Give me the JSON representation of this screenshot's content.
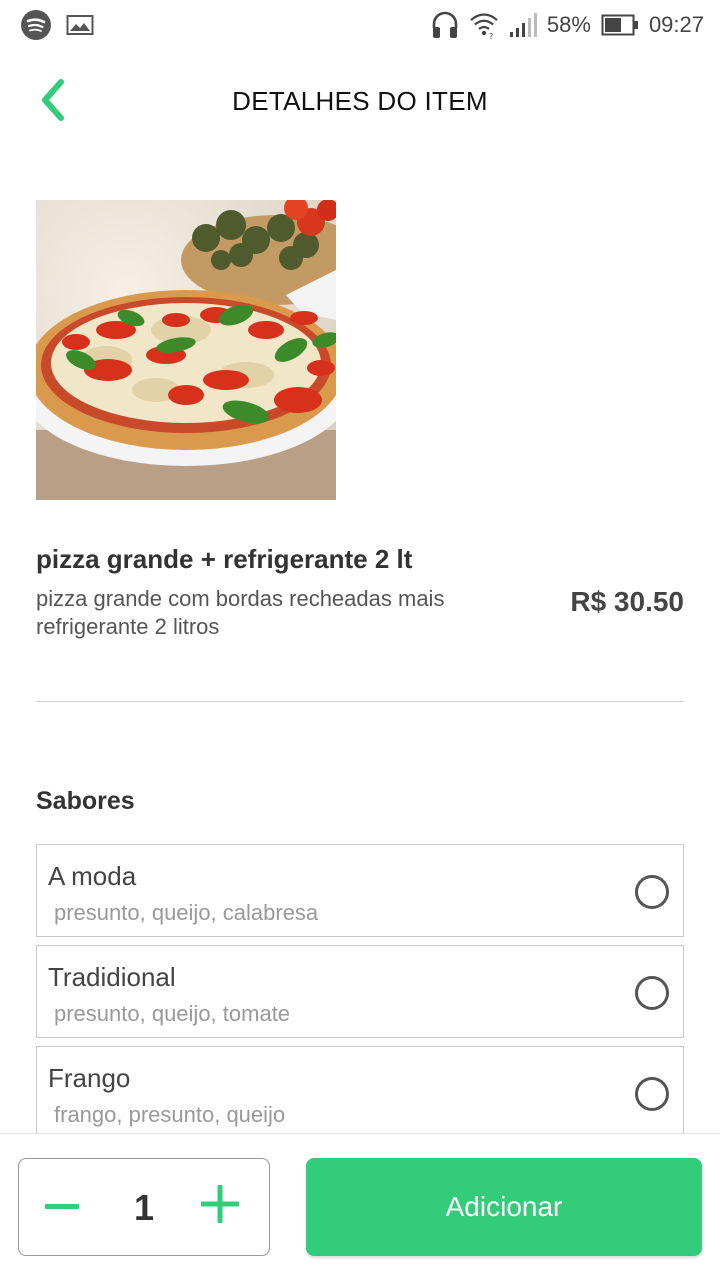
{
  "status_bar": {
    "left_icons": [
      "spotify-icon",
      "image-icon"
    ],
    "right_icons": [
      "headphones-icon",
      "wifi-icon",
      "signal-icon",
      "battery-icon"
    ],
    "battery_percent": "58%",
    "time": "09:27"
  },
  "header": {
    "back_icon": "chevron-left-icon",
    "title": "DETALHES DO ITEM"
  },
  "product": {
    "name": "pizza grande + refrigerante 2 lt",
    "description": "pizza grande com bordas recheadas mais refrigerante 2 litros",
    "price": "R$ 30.50"
  },
  "flavors": {
    "title": "Sabores",
    "options": [
      {
        "name": "A moda",
        "ingredients": "presunto, queijo, calabresa"
      },
      {
        "name": "Tradidional",
        "ingredients": "presunto, queijo, tomate"
      },
      {
        "name": "Frango",
        "ingredients": "frango, presunto, queijo"
      }
    ]
  },
  "bottom": {
    "quantity": "1",
    "add_label": "Adicionar"
  },
  "colors": {
    "accent": "#33cc7a",
    "text_dark": "#333333",
    "text_muted": "#999999"
  }
}
